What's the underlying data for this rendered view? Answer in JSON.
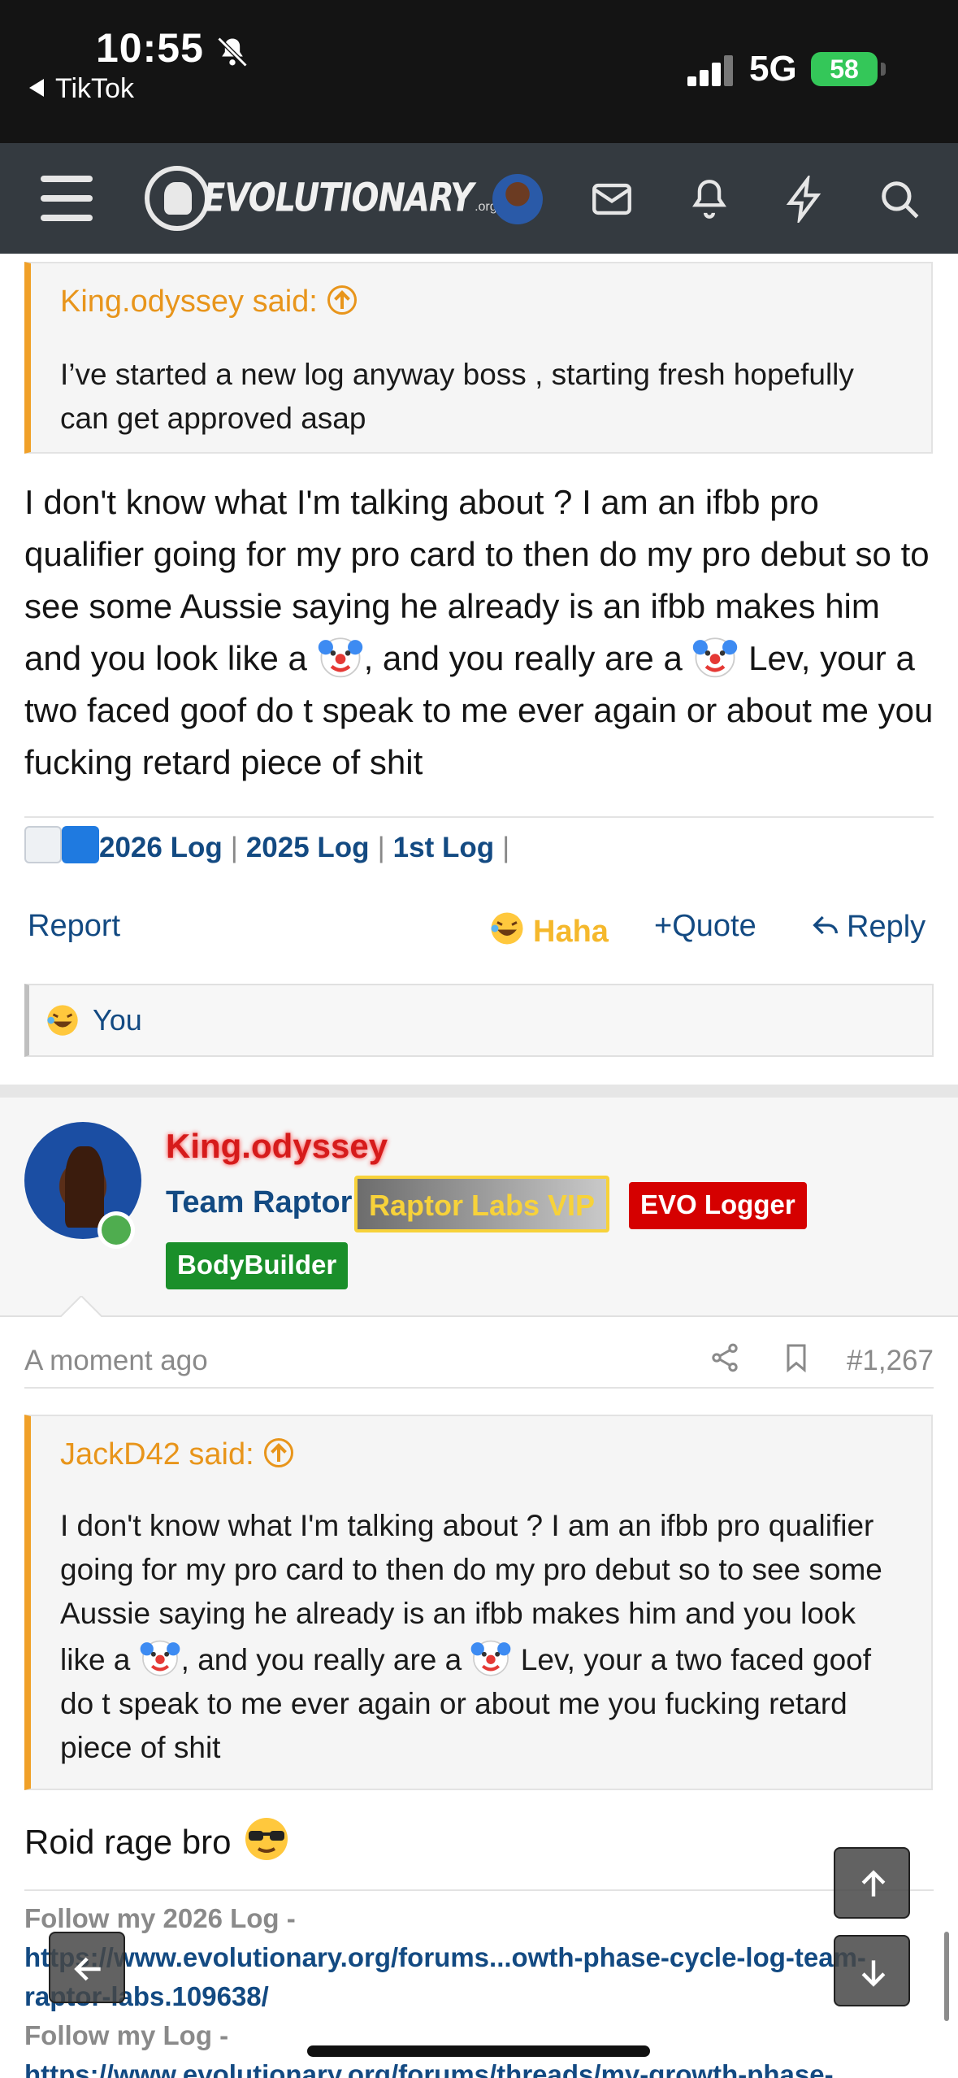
{
  "status_bar": {
    "time": "10:55",
    "back_app": "TikTok",
    "network": "5G",
    "battery": "58"
  },
  "header": {
    "logo_text": "EVOLUTIONARY",
    "logo_suffix": ".org",
    "icons": [
      "menu-icon",
      "avatar",
      "mail-icon",
      "bell-icon",
      "bolt-icon",
      "search-icon"
    ]
  },
  "post1": {
    "quote_author": "King.odyssey said:",
    "quote_text": "I’ve started a new log anyway boss , starting fresh hopefully can get approved asap",
    "body_part1": "I don't know what I'm talking about ? I am an ifbb pro qualifier going for my pro card to then do my pro debut so to see some Aussie saying he already is an ifbb makes him and you look like a ",
    "body_part2": ", and you really are a ",
    "body_part3": " Lev, your a two faced goof do t speak to me ever again or about me you fucking retard piece of shit",
    "signature": {
      "links": [
        "2026 Log",
        "2025 Log",
        "1st Log"
      ],
      "separator": "|"
    },
    "actions": {
      "report": "Report",
      "haha": "Haha",
      "quote": "Quote",
      "reply": "Reply"
    },
    "reaction_summary": "You"
  },
  "post2": {
    "username": "King.odyssey",
    "user_title": "Team Raptor",
    "badges": [
      "Raptor Labs VIP",
      "EVO Logger",
      "BodyBuilder"
    ],
    "timestamp": "A moment ago",
    "post_number": "#1,267",
    "quote_author": "JackD42 said:",
    "quote_part1": "I don't know what I'm talking about ? I am an ifbb pro qualifier going for my pro card to then do my pro debut so to see some Aussie saying he already is an ifbb makes him and you look like a ",
    "quote_part2": ", and you really are a ",
    "quote_part3": " Lev, your a two faced goof do t speak to me ever again or about me you fucking retard piece of shit",
    "body": "Roid rage bro",
    "signature": {
      "label1": "Follow my 2026 Log -",
      "link1": "https://www.evolutionary.org/forums...owth-phase-cycle-log-team-raptor-labs.109638/",
      "label2": "Follow my Log -",
      "link2": "https://www.evolutionary.org/forums/threads/my-growth-phase-"
    }
  },
  "colors": {
    "accent_link": "#134a82",
    "quote_border": "#f0a028",
    "haha": "#f5b82c",
    "username": "#d61b1b",
    "badge_logger": "#d50000",
    "badge_bodybuilder": "#1a8f2a"
  }
}
